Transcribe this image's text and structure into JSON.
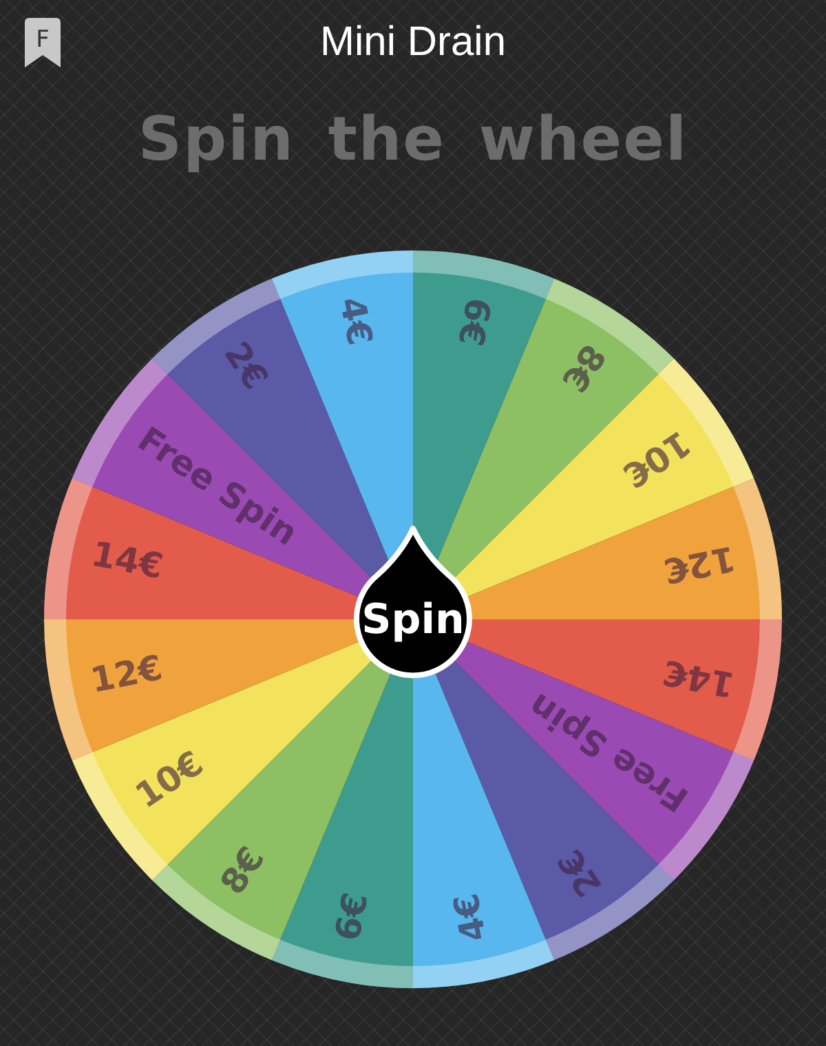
{
  "header": {
    "badge": "F",
    "title": "Mini Drain"
  },
  "heading": "Spin the wheel",
  "wheel": {
    "segments": [
      {
        "label": "6€",
        "color": "#3e9c8f"
      },
      {
        "label": "8€",
        "color": "#8cc063"
      },
      {
        "label": "10€",
        "color": "#f3e25c"
      },
      {
        "label": "12€",
        "color": "#f0a33d"
      },
      {
        "label": "14€",
        "color": "#e35b4a"
      },
      {
        "label": "Free Spin",
        "color": "#9a4bb3"
      },
      {
        "label": "2€",
        "color": "#5b5aa7"
      },
      {
        "label": "4€",
        "color": "#58b7ee"
      },
      {
        "label": "6€",
        "color": "#3e9c8f"
      },
      {
        "label": "8€",
        "color": "#8cc063"
      },
      {
        "label": "10€",
        "color": "#f3e25c"
      },
      {
        "label": "12€",
        "color": "#f0a33d"
      },
      {
        "label": "14€",
        "color": "#e35b4a"
      },
      {
        "label": "Free Spin",
        "color": "#9a4bb3"
      },
      {
        "label": "2€",
        "color": "#5b5aa7"
      },
      {
        "label": "4€",
        "color": "#58b7ee"
      }
    ],
    "spin_button": "Spin"
  }
}
